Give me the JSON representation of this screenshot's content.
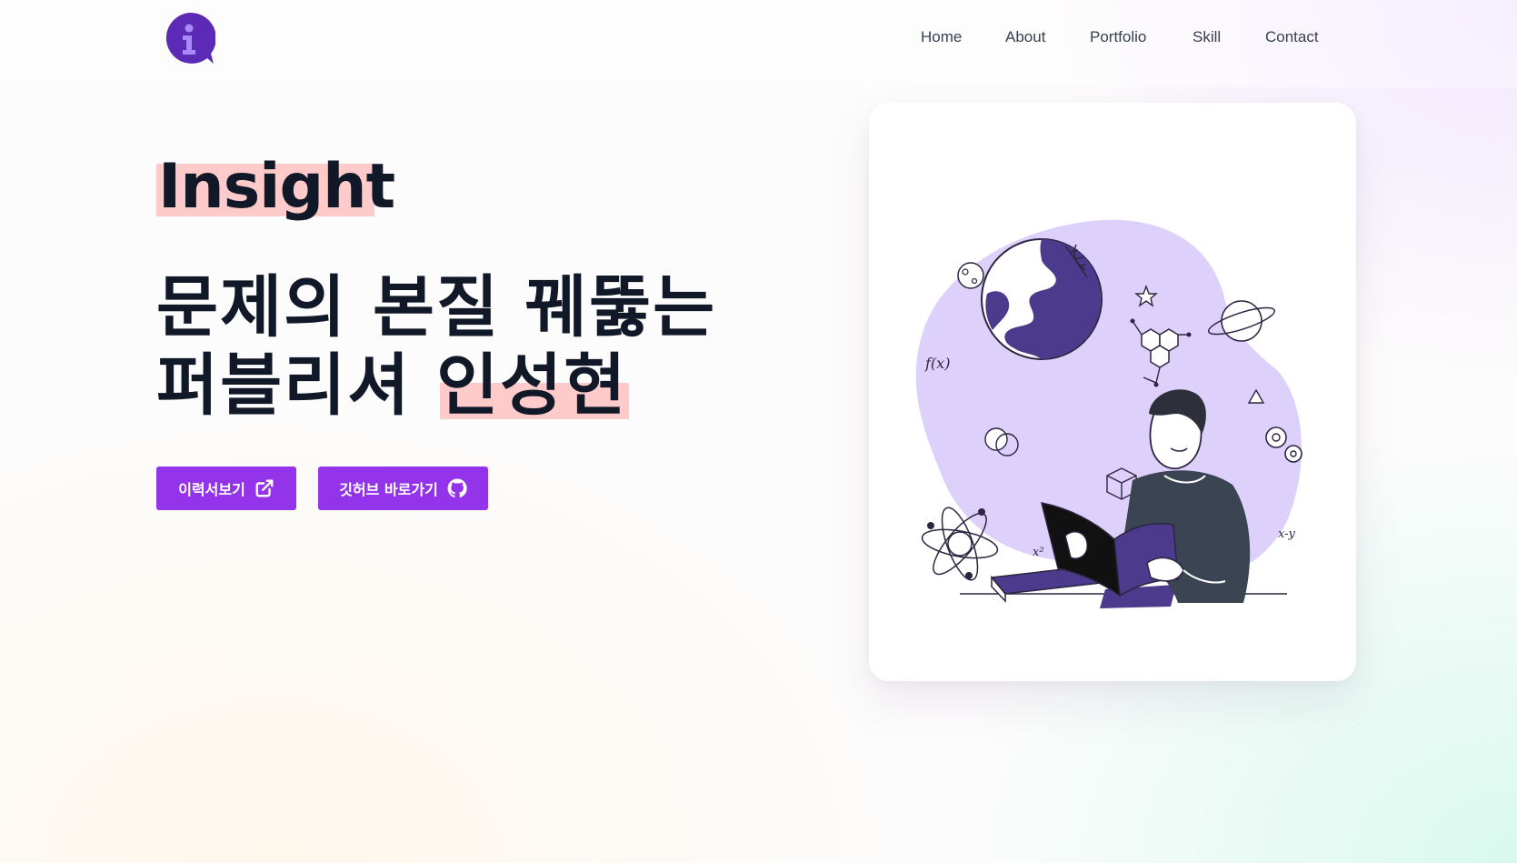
{
  "nav": {
    "items": [
      "Home",
      "About",
      "Portfolio",
      "Skill",
      "Contact"
    ]
  },
  "hero": {
    "brand": "Insight",
    "headline_line1": "문제의 본질 꿰뚫는",
    "headline_line2_prefix": "퍼블리셔 ",
    "headline_name": "인성현"
  },
  "buttons": {
    "resume_label": "이력서보기",
    "github_label": "깃허브 바로가기"
  },
  "colors": {
    "accent": "#9333ea",
    "highlight": "#fecaca",
    "blob": "#ddd0fb",
    "logo": "#5b2bb5",
    "text": "#111827"
  },
  "icons": {
    "logo": "info-bubble-icon",
    "resume": "external-link-icon",
    "github": "github-icon"
  }
}
